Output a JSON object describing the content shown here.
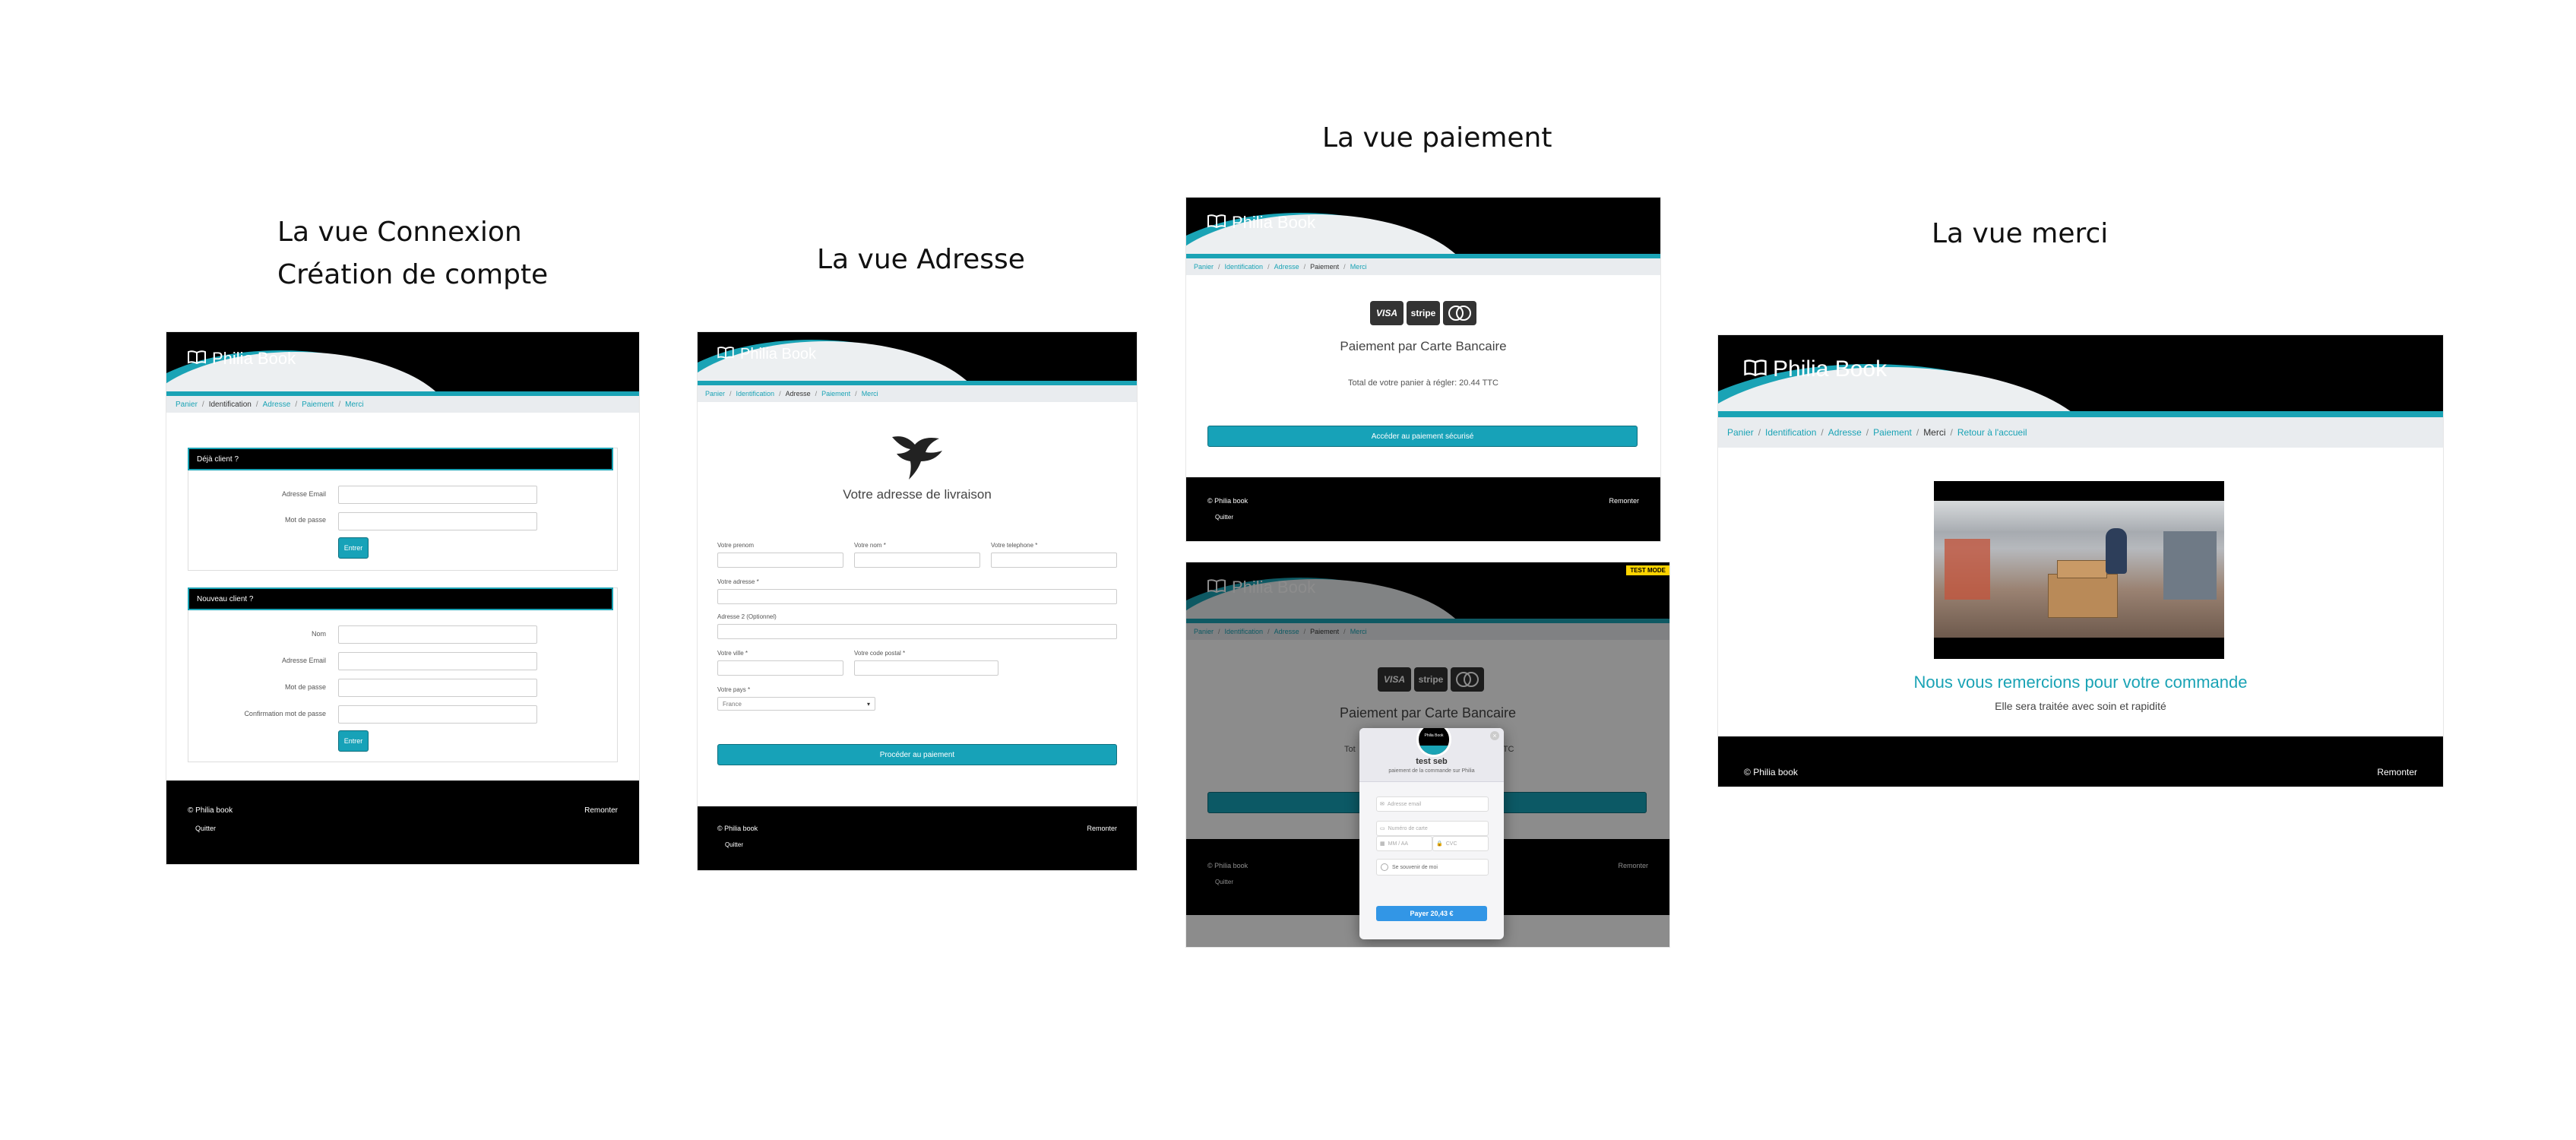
{
  "captions": {
    "connexion_line1": "La vue Connexion",
    "connexion_line2": "Création de compte",
    "adresse": "La vue Adresse",
    "paiement": "La vue paiement",
    "merci": "La vue merci"
  },
  "brand": {
    "name": "Philia Book",
    "footer_name": "Philia book"
  },
  "footer": {
    "remonter": "Remonter",
    "quitter": "Quitter"
  },
  "connexion": {
    "crumbs": [
      "Panier",
      "Identification",
      "Adresse",
      "Paiement",
      "Merci"
    ],
    "active_index": 1,
    "existing": {
      "title": "Déjà client ?",
      "email_label": "Adresse Email",
      "password_label": "Mot de passe",
      "button": "Entrer"
    },
    "new": {
      "title": "Nouveau client ?",
      "name_label": "Nom",
      "email_label": "Adresse Email",
      "password_label": "Mot de passe",
      "confirm_label": "Confirmation mot de passe",
      "button": "Entrer"
    }
  },
  "adresse": {
    "crumbs": [
      "Panier",
      "Identification",
      "Adresse",
      "Paiement",
      "Merci"
    ],
    "active_index": 2,
    "title": "Votre adresse de livraison",
    "firstname_label": "Votre prenom",
    "lastname_label": "Votre nom *",
    "phone_label": "Votre telephone *",
    "address_label": "Votre adresse *",
    "address2_label": "Adresse 2 (Optionnel)",
    "city_label": "Votre ville *",
    "zip_label": "Votre code postal *",
    "country_label": "Votre pays *",
    "country_value": "France",
    "button": "Procéder au paiement"
  },
  "paiement": {
    "crumbs": [
      "Panier",
      "Identification",
      "Adresse",
      "Paiement",
      "Merci"
    ],
    "active_index": 3,
    "cards": [
      "VISA",
      "stripe",
      "mastercard"
    ],
    "title": "Paiement par Carte Bancaire",
    "total": "Total de votre panier à régler: 20.44 TTC",
    "button": "Accéder au paiement sécurisé"
  },
  "stripe": {
    "badge": "TEST MODE",
    "title_partial": "Paiement par Carte Bancaire",
    "total_partial_left": "Tot",
    "total_partial_right": "TTC",
    "logo_text": "Philia Book",
    "merchant": "test seb",
    "description": "paiement de la commande sur Philia",
    "email_placeholder": "Adresse email",
    "card_placeholder": "Numéro de carte",
    "expiry_placeholder": "MM / AA",
    "cvc_placeholder": "CVC",
    "remember": "Se souvenir de moi",
    "pay_button": "Payer 20,43 €"
  },
  "merci": {
    "crumbs": [
      "Panier",
      "Identification",
      "Adresse",
      "Paiement",
      "Merci",
      "Retour à l'accueil"
    ],
    "active_index": 4,
    "title": "Nous vous remercions pour votre commande",
    "subtitle": "Elle sera traitée avec soin et rapidité"
  },
  "colors": {
    "accent": "#1aa3b5",
    "button": "#17a2b8",
    "header": "#000000",
    "crumbs_bg": "#e9ecef"
  }
}
